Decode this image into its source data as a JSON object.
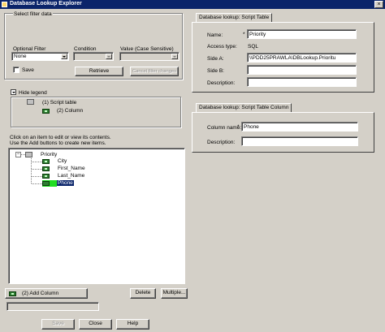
{
  "window": {
    "title": "Database Lookup Explorer",
    "close_glyph": "×"
  },
  "filter": {
    "group_title": "Select filter data",
    "optional_filter_label": "Optional Filter",
    "optional_filter_value": "None",
    "condition_label": "Condition",
    "condition_value": "",
    "value_label": "Value (Case Sensitive)",
    "value_value": "",
    "save_label": "Save",
    "save_checked": false,
    "retrieve_label": "Retrieve",
    "cancel_label": "Cancel filter changes"
  },
  "legend": {
    "toggle_label": "Hide legend",
    "table_label": "(1) Script table",
    "column_label": "(2) Column"
  },
  "instructions": {
    "line1": "Click on an item to edit or view its contents.",
    "line2": "Use the Add buttons to create new items."
  },
  "tree": {
    "root": "Priority",
    "children": [
      "City",
      "First_Name",
      "Last_Name",
      "Phone"
    ],
    "selected": "Phone",
    "expander": "−"
  },
  "bottom_buttons": {
    "add_column": "(2) Add Column",
    "delete": "Delete",
    "multiple": "Multiple..."
  },
  "footer": {
    "save": "Save",
    "close": "Close",
    "help": "Help"
  },
  "script_table": {
    "tab_label": "Database lookup: Script Table",
    "name_label": "Name:",
    "name_required": "*",
    "name_value": "Priority",
    "access_type_label": "Access type:",
    "access_type_value": "SQL",
    "side_a_label": "Side A:",
    "side_a_value": "\\\\PDD25PRAWLA\\DBLookup.Prioritu",
    "side_b_label": "Side B:",
    "side_b_value": "",
    "description_label": "Description:",
    "description_value": ""
  },
  "script_column": {
    "tab_label": "Database lookup: Script Table Column",
    "name_label": "Column name:",
    "name_required": "*",
    "name_value": "Phone",
    "description_label": "Description:",
    "description_value": ""
  },
  "colors": {
    "titlebar": "#0a246a",
    "face": "#d4d0c8",
    "selection": "#0a246a",
    "column_icon": "#2e7d32",
    "selected_icon": "#22dd22"
  }
}
